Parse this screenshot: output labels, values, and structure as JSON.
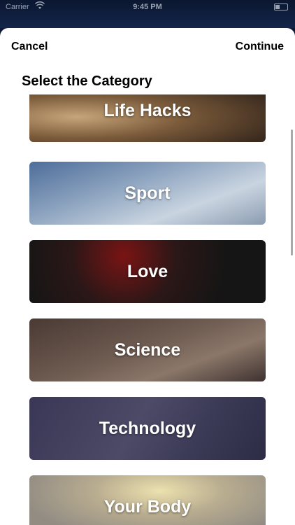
{
  "status_bar": {
    "carrier": "Carrier",
    "time": "9:45 PM"
  },
  "nav": {
    "cancel_label": "Cancel",
    "continue_label": "Continue"
  },
  "section_title": "Select the Category",
  "categories": [
    {
      "label": "Life Hacks"
    },
    {
      "label": "Sport"
    },
    {
      "label": "Love"
    },
    {
      "label": "Science"
    },
    {
      "label": "Technology"
    },
    {
      "label": "Your Body"
    }
  ]
}
